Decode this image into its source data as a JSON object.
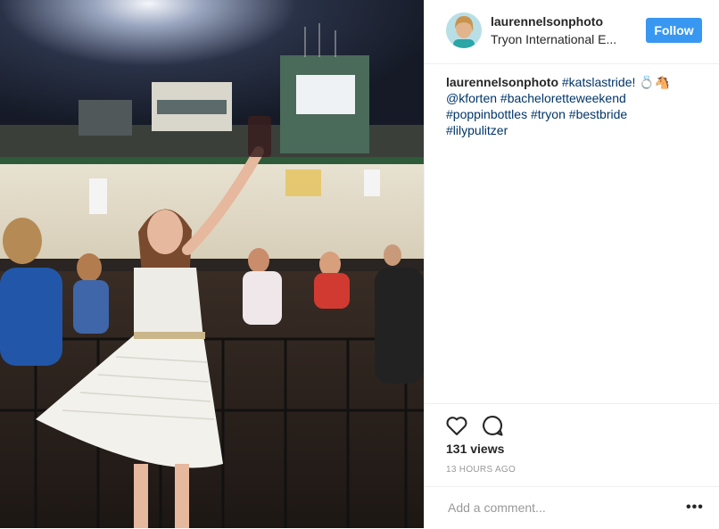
{
  "post": {
    "username": "laurennelsonphoto",
    "location": "Tryon International E...",
    "follow_label": "Follow"
  },
  "caption": {
    "username": "laurennelsonphoto",
    "tag1": "#katslastride!",
    "emoji": "💍🐴",
    "mention": "@kforten",
    "tag2": "#bachelorette​weekend",
    "tag3": "#poppinbottles",
    "tag4": "#tryon",
    "tag5": "#bestbride",
    "tag6": "#lilypulitzer"
  },
  "stats": {
    "views": "131 views",
    "time": "13 HOURS AGO"
  },
  "comment": {
    "placeholder": "Add a comment..."
  },
  "icons": {
    "like": "heart-icon",
    "comment": "comment-icon",
    "more": "more-options-icon"
  },
  "colors": {
    "follow_bg": "#3897f0",
    "hashtag": "#003569",
    "muted": "#999999"
  }
}
